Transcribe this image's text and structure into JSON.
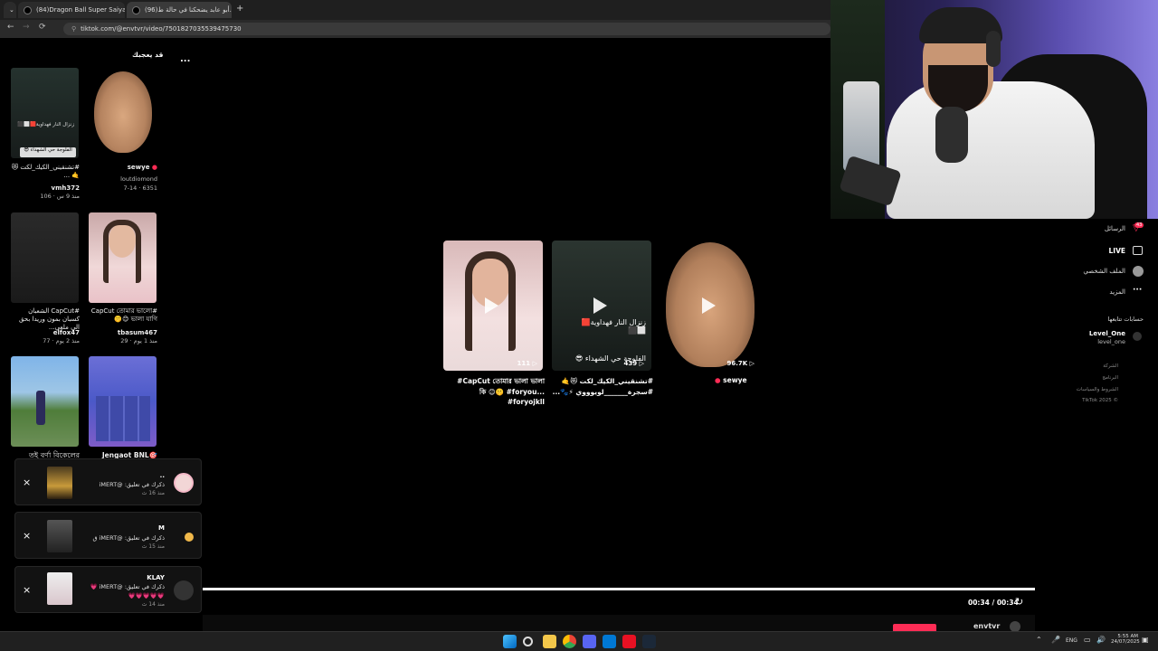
{
  "browser": {
    "tabs": [
      {
        "title": "(84)Dragon Ball Super Saiyan A"
      },
      {
        "title": "(96)أبو عابد يضحكنا في حالة ط..."
      }
    ],
    "new_tab": "+",
    "close": "×",
    "url": "tiktok.com/@envtvr/video/7501827035539475730"
  },
  "left_panel": {
    "header": "قد يعجبك",
    "more": "...",
    "cards": [
      {
        "caption": "#تشنقيني_الكيك_لكت 😻🤙 ...",
        "user": "vmh372",
        "meta": "106 · منذ 9 س",
        "overlay": "زنزال النار فهداوية🟥⬜⬛",
        "overlay2": "الفلوجة حي الشهداء 😎"
      },
      {
        "caption": "sewye",
        "user": "loutdiomond",
        "meta": "7-14 · 6351"
      },
      {
        "caption": "#CapCut الشعبان كسبان بمون وريدا بحق الي ملعي...",
        "user": "elfox47",
        "meta": "77 · منذ 2 يوم"
      },
      {
        "caption": "#CapCut তোমার ভালো ভালা যাগি 😊🤫",
        "user": "tbasum467",
        "meta": "29 · منذ 1 يوم"
      },
      {
        "caption": "তই বর্ণা বিকেলের",
        "user": "",
        "meta": ""
      },
      {
        "caption": "Jengaot BNL🎯",
        "user": "",
        "meta": ""
      }
    ]
  },
  "notifications": [
    {
      "name": "..",
      "text": "ذكرك في تعليق: @iMERT",
      "time": "منذ 16 ث",
      "close": "×"
    },
    {
      "name": "M",
      "text": "ذكرك في تعليق: @iMERT ق",
      "time": "منذ 15 ث",
      "close": "×"
    },
    {
      "name": "KLAY",
      "text": "ذكرك في تعليق: @iMERT 💗",
      "text2": "💗💗💗💗💗",
      "time": "منذ 14 ث",
      "close": "×"
    }
  ],
  "grid": {
    "videos": [
      {
        "count": "111",
        "caption": "CapCut তোমার ভালা ভালা#",
        "caption2": "...কি 😊🤫 #foryou #foryojkll"
      },
      {
        "count": "439",
        "caption": "#تشنقيني_الكيك_لكت 😻🤙",
        "caption2": "#سجرة_______لويوووي ⚡🐾...",
        "overlay": "زنزال النار فهداوية🟥⬜⬛",
        "overlay2": "الفلوجة حي الشهداء 😎"
      },
      {
        "count": "96.7K",
        "caption": "sewye"
      }
    ]
  },
  "player": {
    "time": "00:34 / 00:34",
    "progress": 1.0
  },
  "sidebar": {
    "items": [
      {
        "label": "الرسائل",
        "badge": "43"
      },
      {
        "label": "LIVE"
      },
      {
        "label": "الملف الشخصي"
      },
      {
        "label": "المزيد"
      }
    ],
    "following_header": "حسابات تتابعها",
    "following": {
      "name": "Level_One",
      "handle": "level_one"
    },
    "footer": [
      "الشركة",
      "البرنامج",
      "الشروط والسياسات",
      "TikTok 2025 ©"
    ]
  },
  "bottom_bar": {
    "username": "envtvr"
  },
  "taskbar": {
    "lang": "ENG",
    "clock_time": "5:55 AM",
    "clock_date": "24/07/2025"
  },
  "colors": {
    "accent_pink": "#fe2c55",
    "taskbar": "#202020",
    "tab_active": "#3a3a3a"
  }
}
